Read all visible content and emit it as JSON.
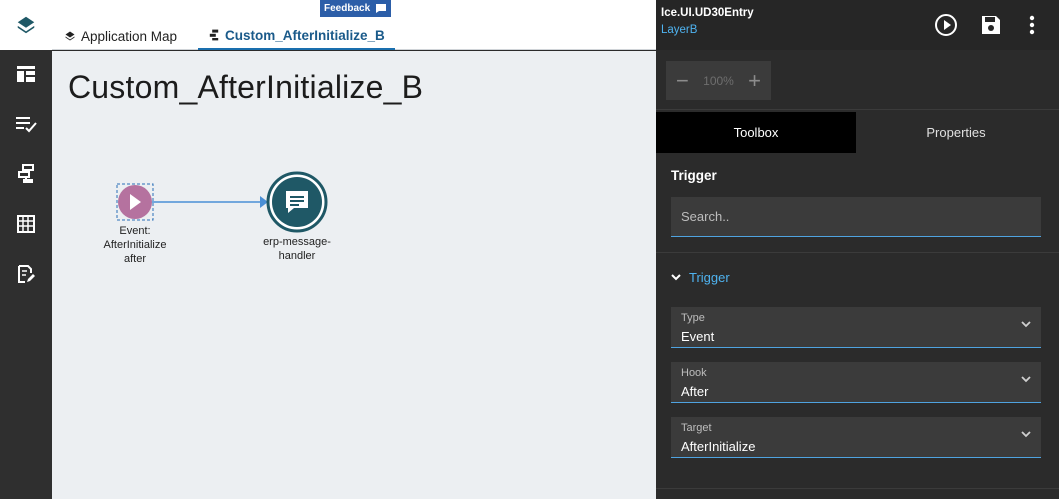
{
  "header": {
    "feedback_label": "Feedback",
    "tabs": [
      {
        "label": "Application Map",
        "icon": "layers-icon",
        "active": false
      },
      {
        "label": "Custom_AfterInitialize_B",
        "icon": "workflow-icon",
        "active": true
      }
    ]
  },
  "nav": {
    "items": [
      {
        "icon": "layout-icon"
      },
      {
        "icon": "checklist-icon"
      },
      {
        "icon": "workflow-icon"
      },
      {
        "icon": "grid-icon"
      },
      {
        "icon": "edit-document-icon"
      }
    ]
  },
  "canvas": {
    "title": "Custom_AfterInitialize_B",
    "nodes": [
      {
        "label_line1": "Event:",
        "label_line2": "AfterInitialize",
        "label_line3": "after",
        "icon": "play-icon",
        "color": "#b5729f"
      },
      {
        "label_line1": "erp-message-",
        "label_line2": "handler",
        "icon": "message-icon",
        "color": "#1f5866"
      }
    ],
    "connector_color": "#4a8fd6"
  },
  "panel": {
    "entry": "Ice.UI.UD30Entry",
    "layer": "LayerB",
    "zoom": {
      "minus": "−",
      "value": "100%",
      "plus": "+"
    },
    "tabs": [
      {
        "label": "Toolbox",
        "active": true
      },
      {
        "label": "Properties",
        "active": false
      }
    ],
    "section_title": "Trigger",
    "search_placeholder": "Search..",
    "collapse_label": "Trigger",
    "fields": [
      {
        "label": "Type",
        "value": "Event"
      },
      {
        "label": "Hook",
        "value": "After"
      },
      {
        "label": "Target",
        "value": "AfterInitialize"
      }
    ]
  },
  "colors": {
    "accent": "#4fb3f0",
    "tab_active": "#1a5a8a",
    "feedback_bg": "#2c5ea8"
  }
}
